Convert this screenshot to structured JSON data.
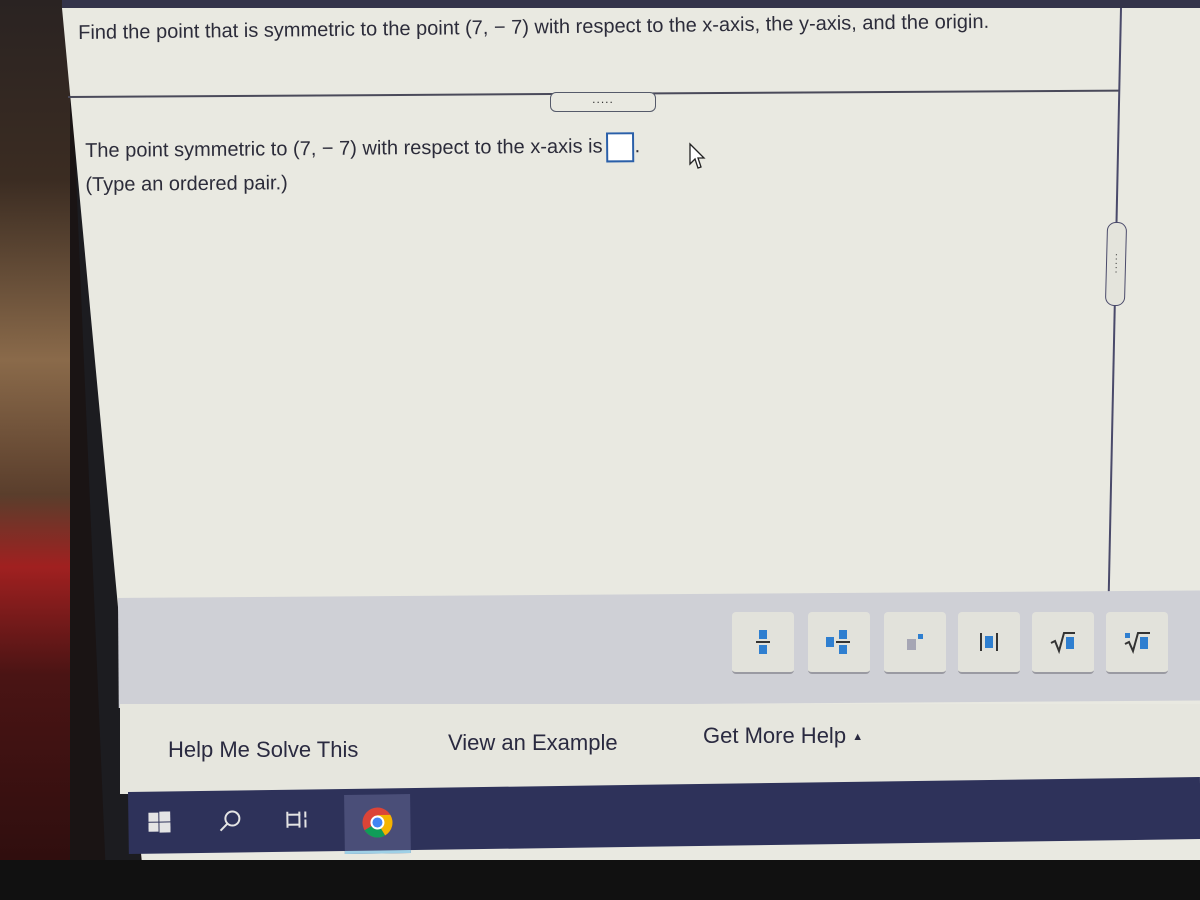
{
  "question": {
    "text": "Find the point that is symmetric to the point (7, − 7) with respect to the x-axis, the y-axis, and the origin."
  },
  "expand_button": {
    "label": "....."
  },
  "answer": {
    "prompt": "The point symmetric to (7, − 7) with respect to the x-axis is",
    "value": "",
    "period": ".",
    "hint": "(Type an ordered pair.)"
  },
  "math_toolbar": {
    "buttons": [
      {
        "name": "fraction",
        "icon": "fraction-icon"
      },
      {
        "name": "mixed-number",
        "icon": "mixed-number-icon"
      },
      {
        "name": "exponent",
        "icon": "exponent-icon"
      },
      {
        "name": "absolute-value",
        "icon": "absolute-value-icon"
      },
      {
        "name": "square-root",
        "icon": "square-root-icon"
      },
      {
        "name": "nth-root",
        "icon": "nth-root-icon"
      }
    ]
  },
  "help": {
    "help_me_solve": "Help Me Solve This",
    "view_example": "View an Example",
    "get_more_help": "Get More Help",
    "get_more_help_arrow": "▲"
  },
  "taskbar": {
    "items": [
      "windows-start",
      "search",
      "task-view",
      "chrome"
    ]
  },
  "colors": {
    "accent_blue": "#2f7fd0",
    "text": "#2c2c3a",
    "taskbar": "#2e325a"
  }
}
